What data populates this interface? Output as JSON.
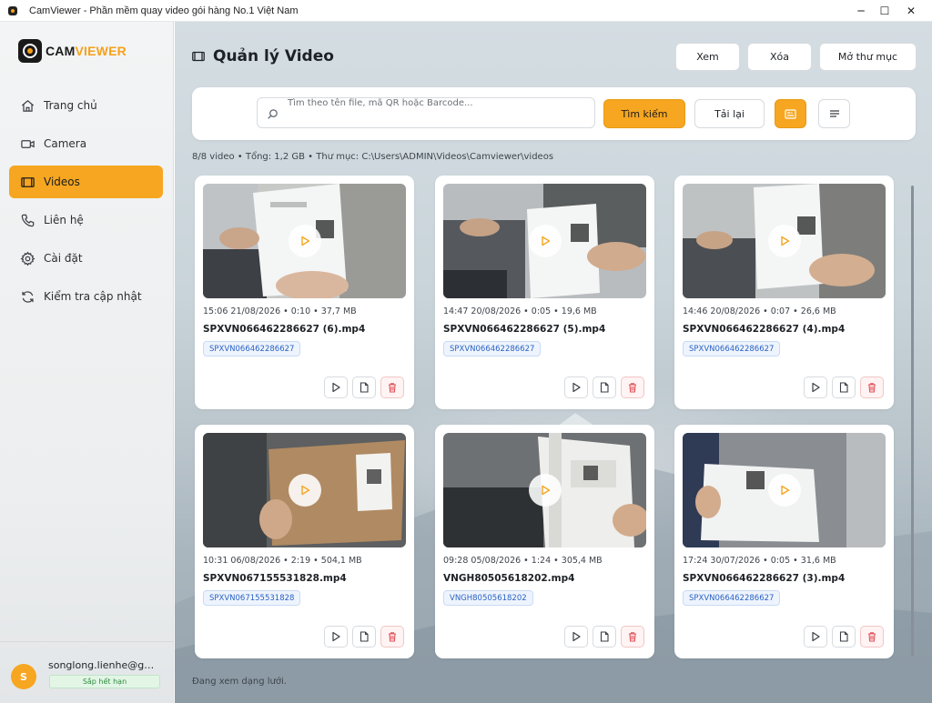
{
  "window": {
    "title": "CamViewer - Phần mềm quay video gói hàng No.1 Việt Nam",
    "controls": [
      "─",
      "☐",
      "✕"
    ]
  },
  "logo": {
    "part1": "CAM",
    "part2": "VIEWER"
  },
  "colors": {
    "accent": "#f6a620",
    "tag_blue": "#2a62c3",
    "danger": "#e0525a"
  },
  "sidebar": {
    "items": [
      {
        "label": "Trang chủ",
        "icon": "home-icon"
      },
      {
        "label": "Camera",
        "icon": "camera-icon"
      },
      {
        "label": "Videos",
        "icon": "video-icon",
        "active": true
      },
      {
        "label": "Liên hệ",
        "icon": "phone-icon"
      },
      {
        "label": "Cài đặt",
        "icon": "gear-icon"
      },
      {
        "label": "Kiểm tra cập nhật",
        "icon": "refresh-icon"
      }
    ],
    "user": {
      "initial": "S",
      "email": "songlong.lienhe@gmail.com",
      "badge": "Sắp hết hạn"
    }
  },
  "header": {
    "title": "Quản lý Video",
    "buttons": {
      "view": "Xem",
      "delete": "Xóa",
      "open_folder": "Mở thư mục"
    }
  },
  "search": {
    "placeholder": "Tìm theo tên file, mã QR hoặc Barcode...",
    "search_label": "Tìm kiếm",
    "reload_label": "Tải lại"
  },
  "summary": "8/8 video • Tổng: 1,2 GB • Thư mục: C:\\Users\\ADMIN\\Videos\\Camviewer\\videos",
  "videos": [
    {
      "meta": "15:06 21/08/2026  •  0:10  •  37,7 MB",
      "name": "SPXVN066462286627 (6).mp4",
      "code": "SPXVN066462286627"
    },
    {
      "meta": "14:47 20/08/2026  •  0:05  •  19,6 MB",
      "name": "SPXVN066462286627 (5).mp4",
      "code": "SPXVN066462286627"
    },
    {
      "meta": "14:46 20/08/2026  •  0:07  •  26,6 MB",
      "name": "SPXVN066462286627 (4).mp4",
      "code": "SPXVN066462286627"
    },
    {
      "meta": "10:31 06/08/2026  •  2:19  •  504,1 MB",
      "name": "SPXVN067155531828.mp4",
      "code": "SPXVN067155531828"
    },
    {
      "meta": "09:28 05/08/2026  •  1:24  •  305,4 MB",
      "name": "VNGH80505618202.mp4",
      "code": "VNGH80505618202"
    },
    {
      "meta": "17:24 30/07/2026  •  0:05  •  31,6 MB",
      "name": "SPXVN066462286627 (3).mp4",
      "code": "SPXVN066462286627"
    }
  ],
  "status": "Đang xem dạng lưới."
}
